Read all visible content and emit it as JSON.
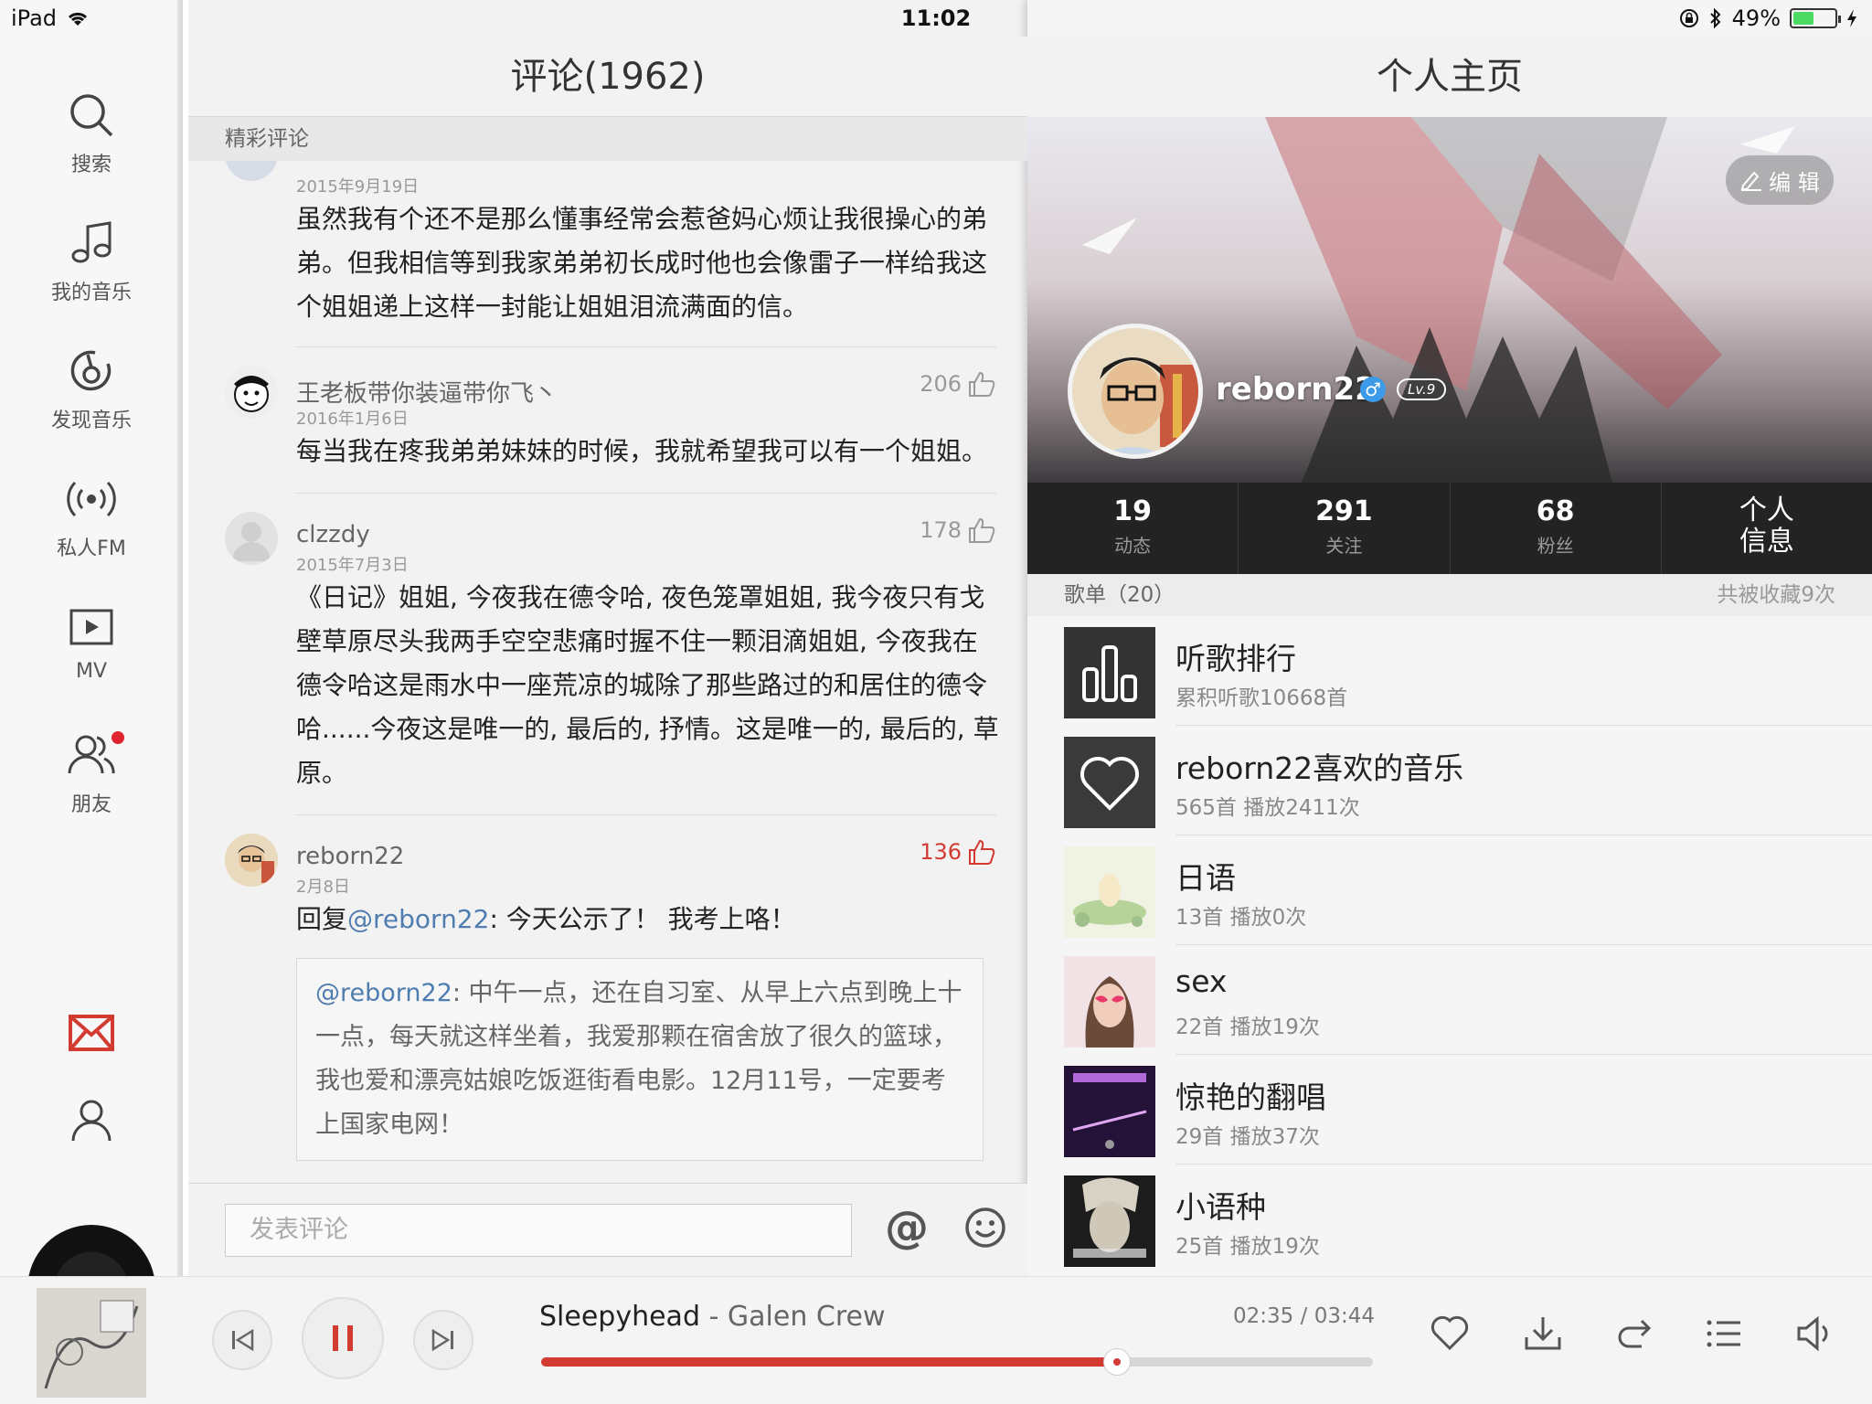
{
  "status": {
    "device": "iPad",
    "time": "11:02",
    "battery": "49%",
    "battery_level": 0.49
  },
  "sidebar": {
    "items": [
      {
        "label": "搜索",
        "icon": "search-icon"
      },
      {
        "label": "我的音乐",
        "icon": "music-note-icon"
      },
      {
        "label": "发现音乐",
        "icon": "netease-logo-icon"
      },
      {
        "label": "私人FM",
        "icon": "radio-icon"
      },
      {
        "label": "MV",
        "icon": "video-icon"
      },
      {
        "label": "朋友",
        "icon": "friends-icon"
      }
    ]
  },
  "comments": {
    "title": "评论(1962)",
    "section_label": "精彩评论",
    "input_placeholder": "发表评论",
    "at_symbol": "@",
    "items": [
      {
        "name": "",
        "date": "2015年9月19日",
        "likes": "",
        "text": "虽然我有个还不是那么懂事经常会惹爸妈心烦让我很操心的弟弟。但我相信等到我家弟弟初长成时他也会像雷子一样给我这个姐姐递上这样一封能让姐姐泪流满面的信。"
      },
      {
        "name": "王老板带你装逼带你飞丶",
        "date": "2016年1月6日",
        "likes": "206",
        "text": "每当我在疼我弟弟妹妹的时候，我就希望我可以有一个姐姐。"
      },
      {
        "name": "clzzdy",
        "date": "2015年7月3日",
        "likes": "178",
        "text": "《日记》姐姐, 今夜我在德令哈, 夜色笼罩姐姐, 我今夜只有戈壁草原尽头我两手空空悲痛时握不住一颗泪滴姐姐, 今夜我在德令哈这是雨水中一座荒凉的城除了那些路过的和居住的德令哈......今夜这是唯一的, 最后的, 抒情。这是唯一的, 最后的, 草原。"
      },
      {
        "name": "reborn22",
        "date": "2月8日",
        "likes": "136",
        "reply_prefix": "回复",
        "reply_mention": "@reborn22",
        "reply_text": ": 今天公示了！ 我考上咯！",
        "quote_mention": "@reborn22",
        "quote_text": ": 中午一点，还在自习室、从早上六点到晚上十一点，每天就这样坐着，我爱那颗在宿舍放了很久的篮球，我也爱和漂亮姑娘吃饭逛街看电影。12月11号，一定要考上国家电网！"
      }
    ]
  },
  "profile": {
    "title": "个人主页",
    "edit_label": "编 辑",
    "username": "reborn22",
    "gender": "♂",
    "level": "Lv.9",
    "stats": [
      {
        "num": "19",
        "label": "动态"
      },
      {
        "num": "291",
        "label": "关注"
      },
      {
        "num": "68",
        "label": "粉丝"
      }
    ],
    "info_line1": "个人",
    "info_line2": "信息",
    "playlist_header": "歌单（20）",
    "collected": "共被收藏9次",
    "playlists": [
      {
        "name": "听歌排行",
        "sub": "累积听歌10668首"
      },
      {
        "name": "reborn22喜欢的音乐",
        "sub": "565首 播放2411次"
      },
      {
        "name": "日语",
        "sub": "13首 播放0次"
      },
      {
        "name": "sex",
        "sub": "22首 播放19次"
      },
      {
        "name": "惊艳的翻唱",
        "sub": "29首 播放37次"
      },
      {
        "name": "小语种",
        "sub": "25首 播放19次"
      }
    ]
  },
  "player": {
    "song": "Sleepyhead",
    "separator": " - ",
    "artist": "Galen Crew",
    "elapsed": "02:35",
    "slash": " / ",
    "duration": "03:44",
    "progress": 0.692
  },
  "colors": {
    "accent": "#d33a31",
    "mention": "#507daf"
  }
}
